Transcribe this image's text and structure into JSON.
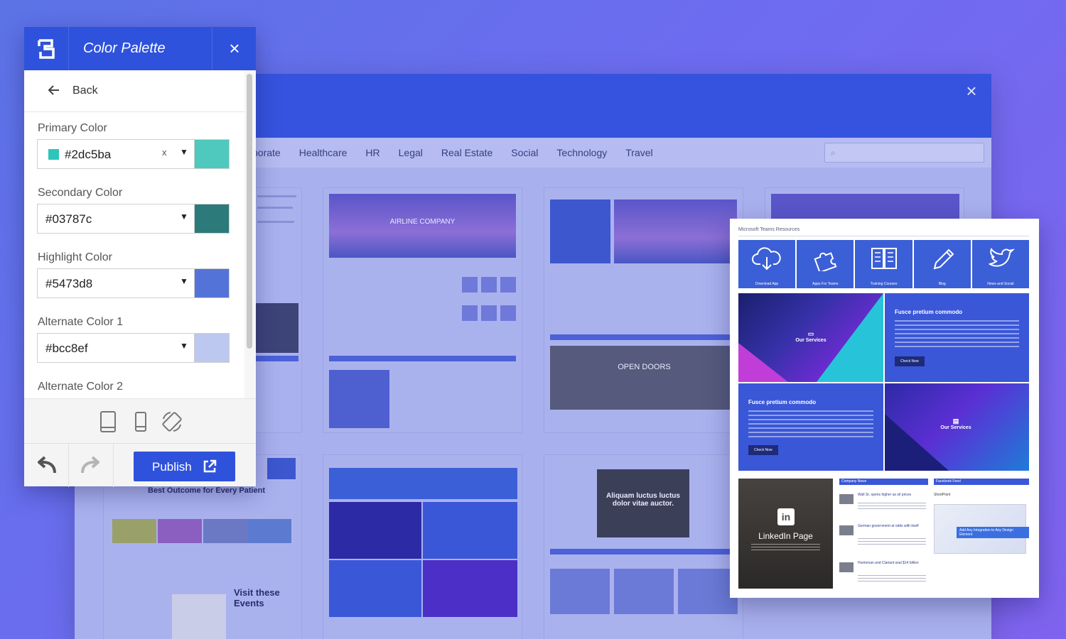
{
  "panel": {
    "title": "Color Palette",
    "back_label": "Back",
    "fields": [
      {
        "label": "Primary Color",
        "value": "#2dc5ba",
        "swatch": "#4fc8bd",
        "clearable": true
      },
      {
        "label": "Secondary Color",
        "value": "#03787c",
        "swatch": "#2d7a7b"
      },
      {
        "label": "Highlight Color",
        "value": "#5473d8",
        "swatch": "#5473d8"
      },
      {
        "label": "Alternate Color 1",
        "value": "#bcc8ef",
        "swatch": "#bcc8ef"
      },
      {
        "label": "Alternate Color 2"
      }
    ],
    "clear_glyph": "x",
    "caret_glyph": "▼",
    "publish_label": "Publish"
  },
  "gallery": {
    "tabs": [
      "porate",
      "Healthcare",
      "HR",
      "Legal",
      "Real Estate",
      "Social",
      "Technology",
      "Travel"
    ],
    "search_placeholder": "",
    "thumb_texts": {
      "airline": "AIRLINE COMPANY",
      "open_doors": "OPEN DOORS",
      "best_outcome": "Best Outcome for Every Patient",
      "visit_events": "Visit these Events",
      "corporate": "Corporate",
      "aliquam": "Aliquam luctus luctus dolor vitae auctor."
    }
  },
  "card": {
    "title": "Microsoft Teams Resources",
    "tiles": [
      "Download App",
      "Apps For Teams",
      "Training Courses",
      "Blog",
      "News and Social"
    ],
    "services": "Our Services",
    "fusce": "Fusce pretium commodo",
    "check_now": "Check Now",
    "linkedin": "LinkedIn Page",
    "company_news": "Company News",
    "facebook_feed": "Facebook Feed",
    "news": [
      "Wall St. opens higher as oil prices",
      "German government at odds with itself",
      "Huntsman and Clariant seal $14 billion"
    ],
    "fb_name": "ShortPoint",
    "fb_banner": "Add Any Integration to Any Design Element"
  },
  "colors": {
    "accent": "#2f52dc",
    "primary": "#2dc5ba",
    "secondary": "#03787c",
    "highlight": "#5473d8",
    "alternate1": "#bcc8ef"
  }
}
